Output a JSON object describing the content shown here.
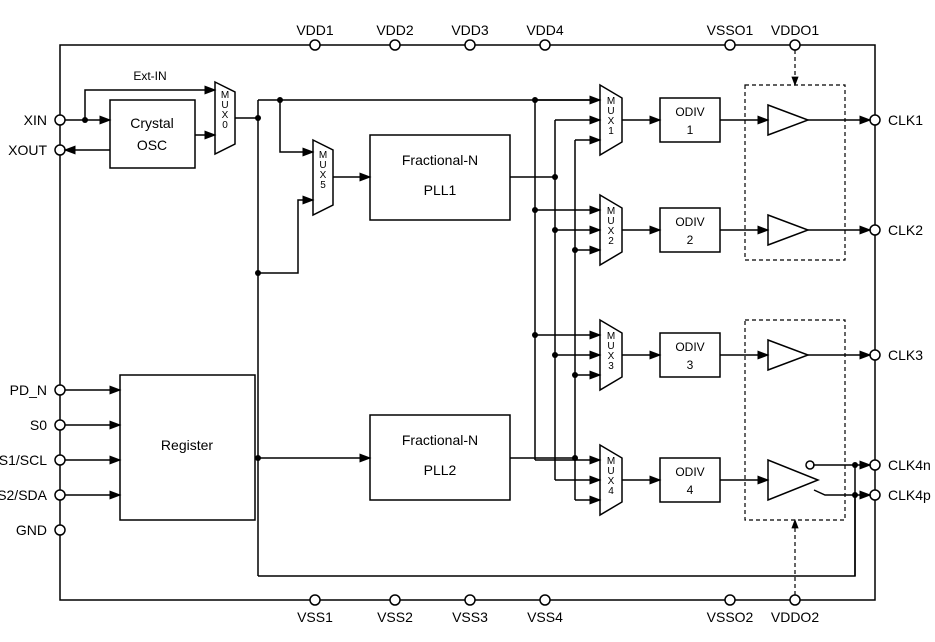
{
  "pins_top": [
    "VDD1",
    "VDD2",
    "VDD3",
    "VDD4",
    "VSSO1",
    "VDDO1"
  ],
  "pins_bottom": [
    "VSS1",
    "VSS2",
    "VSS3",
    "VSS4",
    "VSSO2",
    "VDDO2"
  ],
  "pins_left": [
    "XIN",
    "XOUT",
    "PD_N",
    "S0",
    "S1/SCL",
    "S2/SDA",
    "GND"
  ],
  "pins_right": [
    "CLK1",
    "CLK2",
    "CLK3",
    "CLK4n",
    "CLK4p"
  ],
  "ext_in_label": "Ext-IN",
  "blocks": {
    "osc_l1": "Crystal",
    "osc_l2": "OSC",
    "register": "Register",
    "pll1_l1": "Fractional-N",
    "pll1_l2": "PLL1",
    "pll2_l1": "Fractional-N",
    "pll2_l2": "PLL2",
    "odiv1_l1": "ODIV",
    "odiv1_l2": "1",
    "odiv2_l1": "ODIV",
    "odiv2_l2": "2",
    "odiv3_l1": "ODIV",
    "odiv3_l2": "3",
    "odiv4_l1": "ODIV",
    "odiv4_l2": "4",
    "mux0": "MUX0",
    "mux1": "MUX1",
    "mux2": "MUX2",
    "mux3": "MUX3",
    "mux4": "MUX4",
    "mux5": "MUX5"
  }
}
